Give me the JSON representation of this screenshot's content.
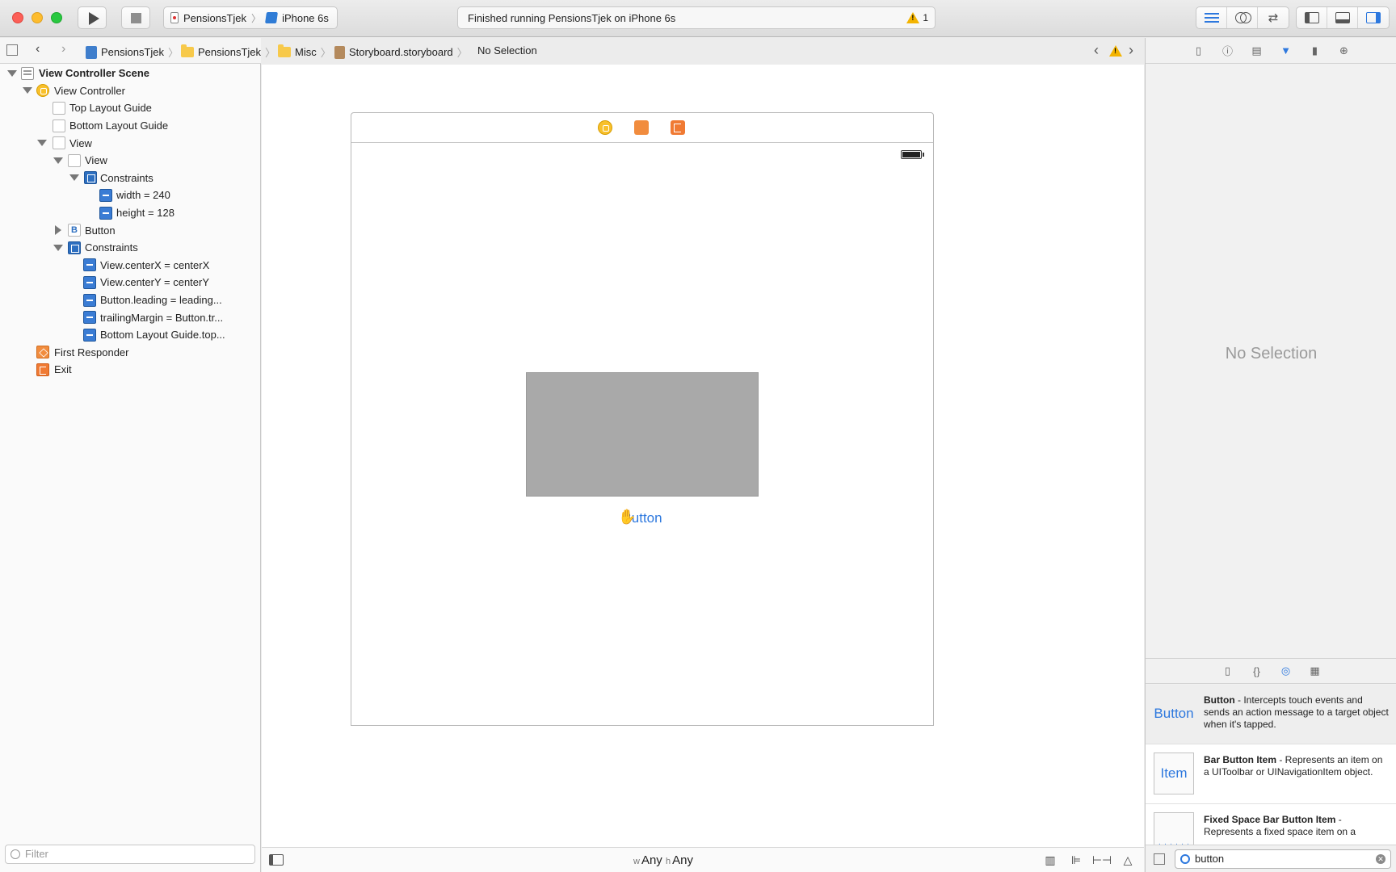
{
  "toolbar": {
    "scheme": "PensionsTjek",
    "device": "iPhone 6s",
    "activity": "Finished running PensionsTjek on iPhone 6s",
    "warning_count": "1"
  },
  "jumpbar": {
    "crumbs": [
      "PensionsTjek",
      "PensionsTjek",
      "Misc",
      "Storyboard.storyboard",
      "No Selection"
    ]
  },
  "outline": [
    {
      "label": "View Controller Scene",
      "icon": "scene-icon"
    },
    {
      "label": "View Controller",
      "icon": "view-controller-icon"
    },
    {
      "label": "Top Layout Guide",
      "icon": "layout-guide-icon"
    },
    {
      "label": "Bottom Layout Guide",
      "icon": "layout-guide-icon"
    },
    {
      "label": "View",
      "icon": "view-icon"
    },
    {
      "label": "View",
      "icon": "view-icon"
    },
    {
      "label": "Constraints",
      "icon": "constraints-icon"
    },
    {
      "label": "width = 240",
      "icon": "constraint-icon"
    },
    {
      "label": "height = 128",
      "icon": "constraint-icon"
    },
    {
      "label": "Button",
      "icon": "button-icon"
    },
    {
      "label": "Constraints",
      "icon": "constraints-icon"
    },
    {
      "label": "View.centerX = centerX",
      "icon": "constraint-icon"
    },
    {
      "label": "View.centerY = centerY",
      "icon": "constraint-icon"
    },
    {
      "label": "Button.leading = leading...",
      "icon": "constraint-icon"
    },
    {
      "label": "trailingMargin = Button.tr...",
      "icon": "constraint-icon"
    },
    {
      "label": "Bottom Layout Guide.top...",
      "icon": "constraint-icon"
    },
    {
      "label": "First Responder",
      "icon": "first-responder-icon"
    },
    {
      "label": "Exit",
      "icon": "exit-icon"
    }
  ],
  "navigator": {
    "filter_placeholder": "Filter"
  },
  "canvas": {
    "button_title": "Button",
    "size_class_w_prefix": "w",
    "size_class_w": "Any",
    "size_class_h_prefix": "h",
    "size_class_h": "Any"
  },
  "inspector": {
    "empty_label": "No Selection"
  },
  "library": {
    "items": [
      {
        "thumb": "Button",
        "name": "Button",
        "desc": " - Intercepts touch events and sends an action message to a target object when it's tapped."
      },
      {
        "thumb": "Item",
        "name": "Bar Button Item",
        "desc": " - Represents an item on a UIToolbar or UINavigationItem object."
      },
      {
        "thumb": "",
        "name": "Fixed Space Bar Button Item",
        "desc": " - Represents a fixed space item on a"
      }
    ],
    "search_value": "button"
  },
  "colors": {
    "accent": "#2d78de",
    "gray_view": "#a9a9a9",
    "warning": "#f4b400"
  }
}
